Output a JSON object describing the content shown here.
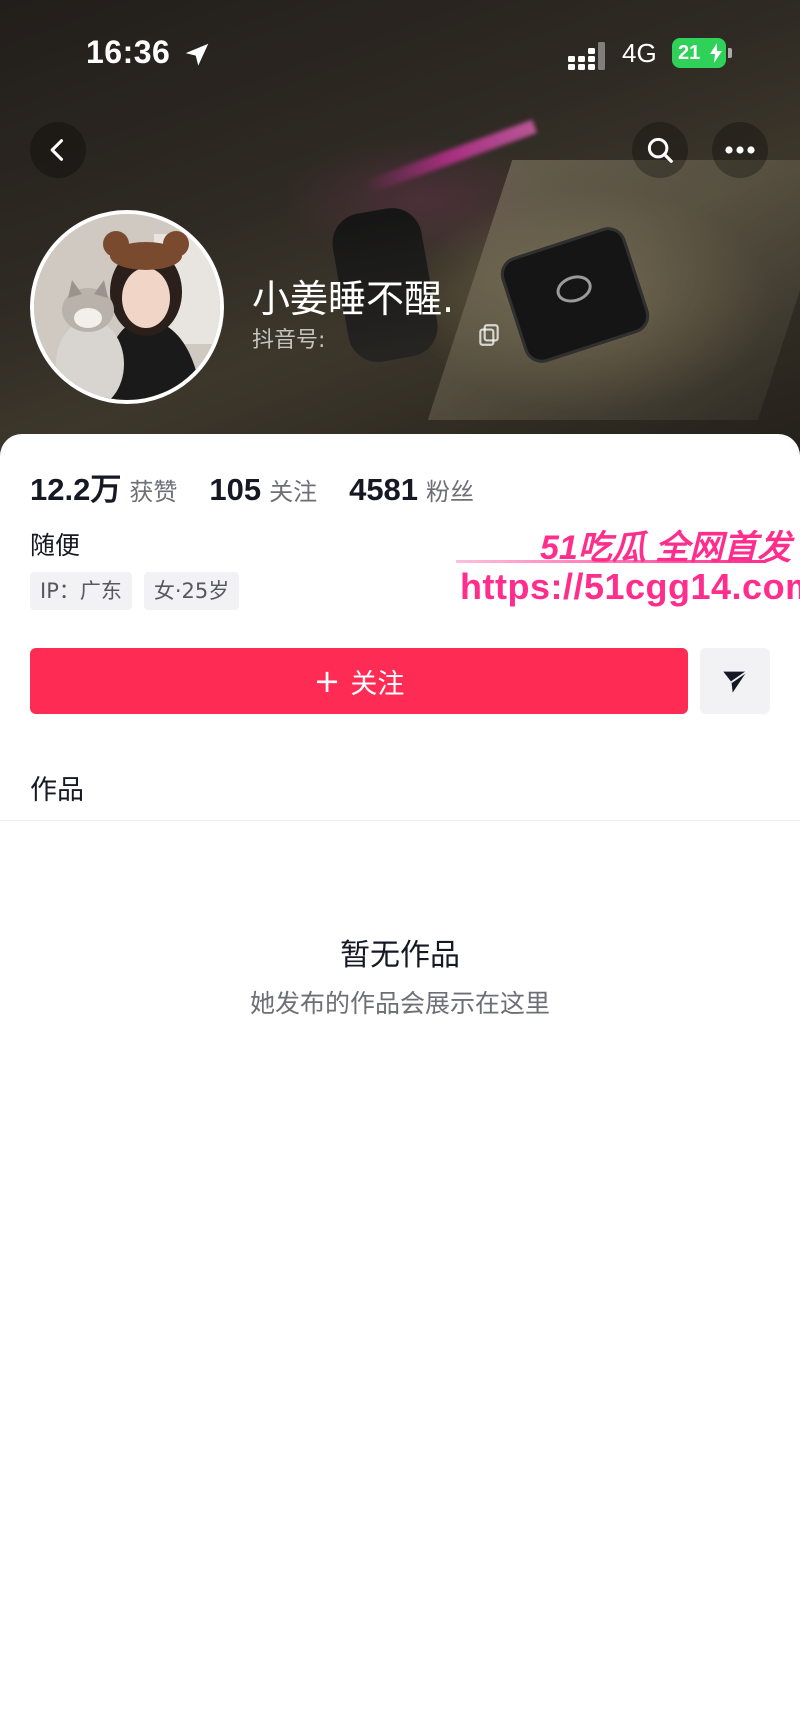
{
  "status_bar": {
    "time": "16:36",
    "network": "4G",
    "battery": "21",
    "battery_color": "#30d158"
  },
  "nav": {
    "back_icon": "chevron-left-icon",
    "search_icon": "search-icon",
    "more_icon": "more-horizontal-icon"
  },
  "profile": {
    "display_name": "小姜睡不醒.",
    "douyin_id_label": "抖音号:",
    "bio": "随便",
    "tags": [
      "IP：广东",
      "女·25岁"
    ]
  },
  "stats": [
    {
      "value": "12.2万",
      "label": "获赞"
    },
    {
      "value": "105",
      "label": "关注"
    },
    {
      "value": "4581",
      "label": "粉丝"
    }
  ],
  "actions": {
    "follow_plus": "+",
    "follow_label": "关注",
    "share_icon": "send-icon",
    "accent_color": "#fe2c55"
  },
  "tabs": {
    "works": "作品"
  },
  "empty_state": {
    "title": "暂无作品",
    "subtitle": "她发布的作品会展示在这里"
  },
  "watermark": {
    "title": "51吃瓜 全网首发",
    "url": "https://51cgg14.com",
    "color": "#ff2e8c"
  }
}
